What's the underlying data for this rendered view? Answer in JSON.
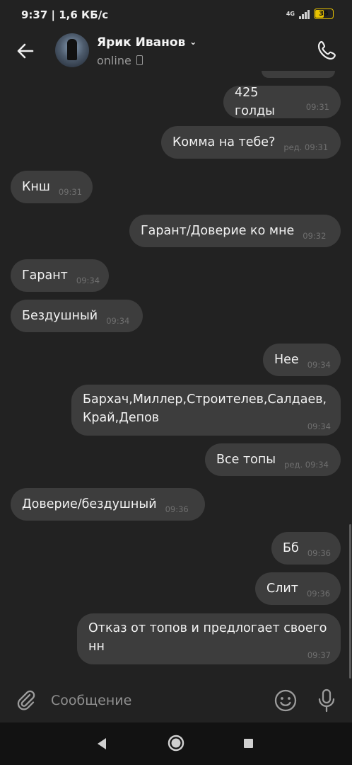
{
  "status_bar": {
    "time": "9:37 | 1,6 КБ/с",
    "network": "4G",
    "battery": "35"
  },
  "header": {
    "contact_name": "Ярик Иванов",
    "presence": "online"
  },
  "messages": [
    {
      "side": "out",
      "text": "425 голды",
      "time": "09:31",
      "edited": ""
    },
    {
      "side": "out",
      "text": "Комма на тебе?",
      "time": "09:31",
      "edited": "ред."
    },
    {
      "side": "in",
      "text": "Кнш",
      "time": "09:31",
      "edited": ""
    },
    {
      "side": "out",
      "text": "Гарант/Доверие ко мне",
      "time": "09:32",
      "edited": ""
    },
    {
      "side": "in",
      "text": "Гарант",
      "time": "09:34",
      "edited": ""
    },
    {
      "side": "in",
      "text": "Бездушный",
      "time": "09:34",
      "edited": ""
    },
    {
      "side": "out",
      "text": "Нее",
      "time": "09:34",
      "edited": ""
    },
    {
      "side": "out",
      "text_line1": "Бархач,Миллер,Строителев,Салдаев,",
      "text_line2": "Край,Депов",
      "time": "09:34",
      "edited": ""
    },
    {
      "side": "out",
      "text": "Все топы",
      "time": "09:34",
      "edited": "ред."
    },
    {
      "side": "in",
      "text": "Доверие/бездушный",
      "time": "09:36",
      "edited": ""
    },
    {
      "side": "out",
      "text": "Бб",
      "time": "09:36",
      "edited": ""
    },
    {
      "side": "out",
      "text": "Слит",
      "time": "09:36",
      "edited": ""
    },
    {
      "side": "out",
      "text_line1": "Отказ от топов и предлогает своего",
      "text_line2": "нн",
      "time": "09:37",
      "edited": ""
    }
  ],
  "composer": {
    "placeholder": "Сообщение",
    "value": ""
  },
  "icons": {
    "back": "arrow-left-icon",
    "call": "phone-icon",
    "attach": "paperclip-icon",
    "emoji": "smile-icon",
    "voice": "microphone-icon"
  },
  "colors": {
    "background": "#222222",
    "bubble": "#3d3d3d",
    "meta_text": "#6f6f6f",
    "battery": "#e8c200"
  }
}
